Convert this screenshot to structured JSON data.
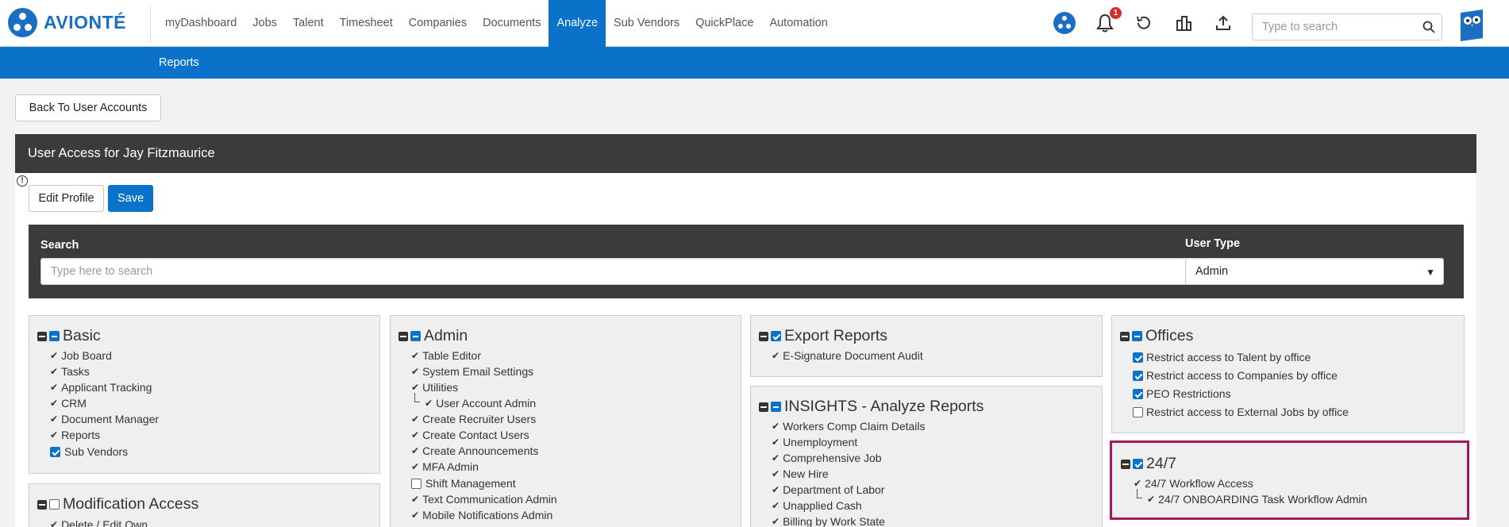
{
  "brand": {
    "name": "AVIONTÉ"
  },
  "nav": {
    "items": [
      "myDashboard",
      "Jobs",
      "Talent",
      "Timesheet",
      "Companies",
      "Documents",
      "Analyze",
      "Sub Vendors",
      "QuickPlace",
      "Automation"
    ],
    "active": "Analyze"
  },
  "header_icons": {
    "notification_count": "1",
    "search_placeholder": "Type to search"
  },
  "subnav": {
    "reports": "Reports"
  },
  "back_button": "Back To User Accounts",
  "panel": {
    "title": "User Access for Jay Fitzmaurice"
  },
  "actions": {
    "edit_profile": "Edit Profile",
    "save": "Save"
  },
  "filter": {
    "search_label": "Search",
    "search_placeholder": "Type here to search",
    "user_type_label": "User Type",
    "user_type_value": "Admin"
  },
  "sections": {
    "basic": {
      "title": "Basic",
      "items": [
        "Job Board",
        "Tasks",
        "Applicant Tracking",
        "CRM",
        "Document Manager",
        "Reports",
        "Sub Vendors"
      ]
    },
    "modification": {
      "title": "Modification Access",
      "items": [
        "Delete / Edit Own"
      ]
    },
    "admin": {
      "title": "Admin",
      "items": [
        "Table Editor",
        "System Email Settings",
        "Utilities",
        "User Account Admin",
        "Create Recruiter Users",
        "Create Contact Users",
        "Create Announcements",
        "MFA Admin",
        "Shift Management",
        "Text Communication Admin",
        "Mobile Notifications Admin"
      ]
    },
    "export_reports": {
      "title": "Export Reports",
      "items": [
        "E-Signature Document Audit"
      ]
    },
    "insights": {
      "title": "INSIGHTS - Analyze Reports",
      "items": [
        "Workers Comp Claim Details",
        "Unemployment",
        "Comprehensive Job",
        "New Hire",
        "Department of Labor",
        "Unapplied Cash",
        "Billing by Work State"
      ]
    },
    "offices": {
      "title": "Offices",
      "items": [
        "Restrict access to Talent by office",
        "Restrict access to Companies by office",
        "PEO Restrictions",
        "Restrict access to External Jobs by office"
      ]
    },
    "twentyfourseven": {
      "title": "24/7",
      "items": [
        "24/7 Workflow Access",
        "24/7 ONBOARDING Task Workflow Admin"
      ]
    }
  }
}
